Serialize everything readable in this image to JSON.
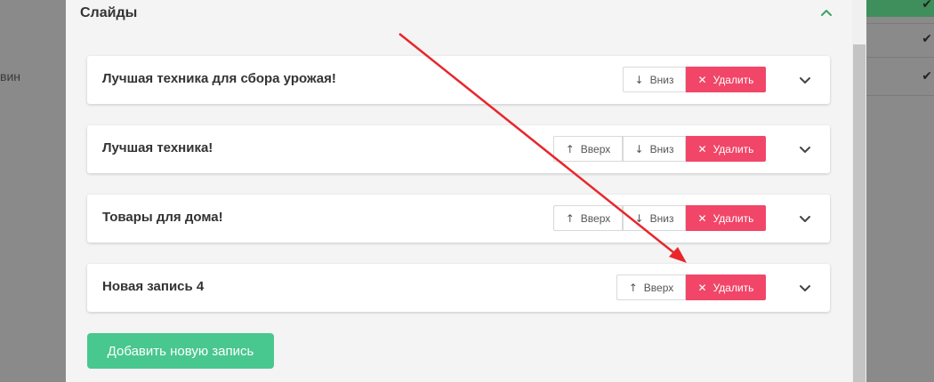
{
  "background": {
    "left_text": "вин",
    "check_mark": "✔"
  },
  "modal": {
    "title": "Слайды"
  },
  "slides": [
    {
      "title": "Лучшая техника для сбора урожая!",
      "buttons": [
        "down",
        "delete"
      ]
    },
    {
      "title": "Лучшая техника!",
      "buttons": [
        "up",
        "down",
        "delete"
      ]
    },
    {
      "title": "Товары для дома!",
      "buttons": [
        "up",
        "down",
        "delete"
      ]
    },
    {
      "title": "Новая запись 4",
      "buttons": [
        "up",
        "delete"
      ]
    }
  ],
  "labels": {
    "up": "Вверх",
    "down": "Вниз",
    "delete": "Удалить"
  },
  "icons": {
    "up": "arrow-up-icon",
    "down": "arrow-down-icon",
    "delete": "close-icon",
    "expand": "chevron-down-icon",
    "collapse": "chevron-up-icon"
  },
  "add_button_label": "Добавить новую запись",
  "colors": {
    "delete": "#f14668",
    "add": "#48c78e",
    "accent_chevron": "#3f9f6a",
    "annotation_arrow": "#e8262b"
  }
}
